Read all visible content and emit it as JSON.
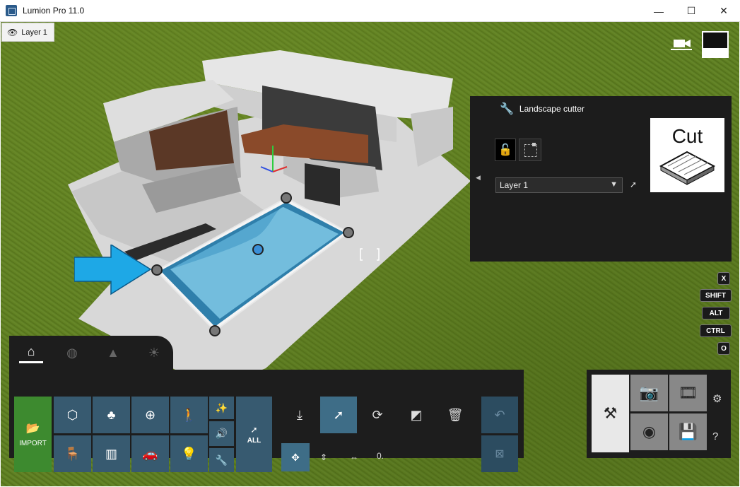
{
  "window": {
    "title": "Lumion Pro 11.0",
    "minimize_glyph": "—",
    "maximize_glyph": "☐",
    "close_glyph": "✕"
  },
  "viewport": {
    "layer_badge": "Layer 1"
  },
  "cutter": {
    "title": "Landscape cutter",
    "layer_value": "Layer 1",
    "preview_label": "Cut"
  },
  "keys": [
    "X",
    "SHIFT",
    "ALT",
    "CTRL",
    "O"
  ],
  "toolbar": {
    "import_label": "IMPORT",
    "all_label": "ALL",
    "value_field": "0."
  },
  "colors": {
    "accent": "#375a70",
    "import_green": "#3d8a2f",
    "arrow_blue": "#1ea8e6",
    "selected_tool": "#3e6d87"
  },
  "icons": {
    "eye": "eye-icon",
    "wrench": "wrench-icon",
    "lock": "unlock-icon",
    "camera": "movie-camera-icon"
  }
}
